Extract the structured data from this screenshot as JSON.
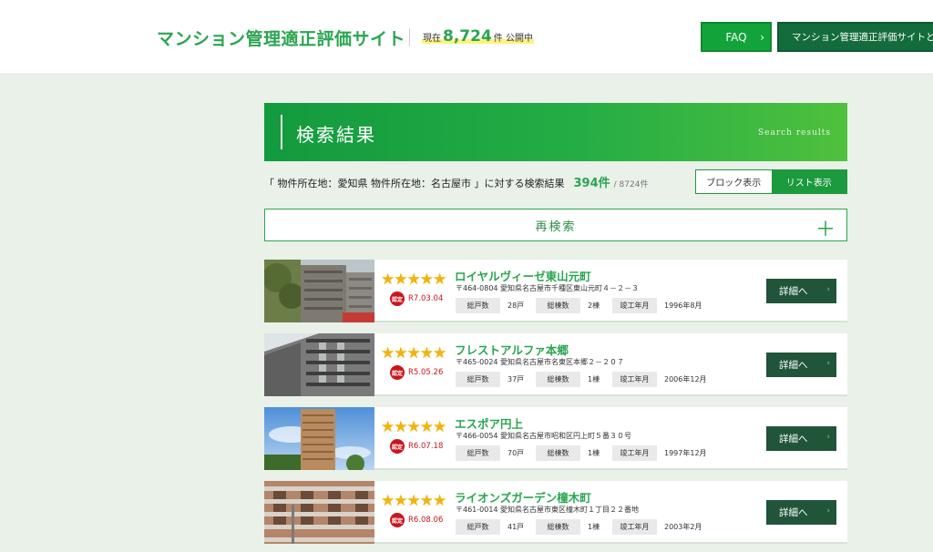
{
  "header": {
    "site_title": "マンション管理適正評価サイト",
    "count_prefix": "現在",
    "count_value": "8,724",
    "count_suffix": "件 公開中",
    "faq_label": "FAQ",
    "about_label": "マンション管理適正評価サイトとは？"
  },
  "banner": {
    "title": "検索結果",
    "subtitle": "Search results"
  },
  "results": {
    "query_text": "「 物件所在地：愛知県 物件所在地：名古屋市 」に対する検索結果",
    "count": "394件",
    "total": "/ 8724件",
    "block_view_label": "ブロック表示",
    "list_view_label": "リスト表示",
    "research_label": "再検索",
    "research_plus": "＋"
  },
  "labels": {
    "total_units": "総戸数",
    "total_buildings": "総棟数",
    "completed": "竣工年月",
    "detail_button": "詳細へ",
    "badge": "認定"
  },
  "listings": [
    {
      "stars": "★★★★★",
      "date": "R7.03.04",
      "name": "ロイヤルヴィーゼ東山元町",
      "address": "〒464-0804 愛知県名古屋市千種区東山元町４－２－３",
      "units": "28戸",
      "buildings": "2棟",
      "completed": "1996年8月"
    },
    {
      "stars": "★★★★★",
      "date": "R5.05.26",
      "name": "フレストアルファ本郷",
      "address": "〒465-0024 愛知県名古屋市名東区本郷２－２０７",
      "units": "37戸",
      "buildings": "1棟",
      "completed": "2006年12月"
    },
    {
      "stars": "★★★★★",
      "date": "R6.07.18",
      "name": "エスポア円上",
      "address": "〒466-0054 愛知県名古屋市昭和区円上町５番３０号",
      "units": "70戸",
      "buildings": "1棟",
      "completed": "1997年12月"
    },
    {
      "stars": "★★★★★",
      "date": "R6.08.06",
      "name": "ライオンズガーデン橦木町",
      "address": "〒461-0014 愛知県名古屋市東区橦木町１丁目２２番地",
      "units": "41戸",
      "buildings": "1棟",
      "completed": "2003年2月"
    }
  ]
}
